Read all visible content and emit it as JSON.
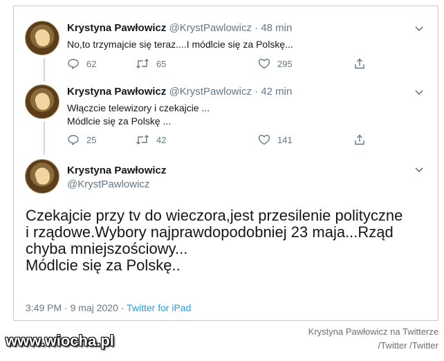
{
  "tweets": [
    {
      "name": "Krystyna Pawłowicz",
      "handle": "@KrystPawlowicz",
      "dot": "·",
      "time": "48 min",
      "lines": [
        "No,to trzymajcie się teraz....I módlcie się za Polskę..."
      ],
      "replies": "62",
      "retweets": "65",
      "likes": "295"
    },
    {
      "name": "Krystyna Pawłowicz",
      "handle": "@KrystPawlowicz",
      "dot": "·",
      "time": "42 min",
      "lines": [
        "Włączcie telewizory i czekajcie ...",
        "Módlcie się za Polskę ..."
      ],
      "replies": "25",
      "retweets": "42",
      "likes": "141"
    }
  ],
  "main_tweet": {
    "name": "Krystyna Pawłowicz",
    "handle": "@KrystPawlowicz",
    "lines": [
      "Czekajcie przy tv do wieczora,jest przesilenie polityczne",
      "i rządowe.Wybory najprawdopodobniej 23 maja...Rząd",
      "chyba mniejszościowy...",
      "Módlcie się za Polskę.."
    ],
    "time": "3:49 PM",
    "date": "9 maj 2020",
    "sep": "·",
    "source": "Twitter for iPad"
  },
  "watermark": "www.wiocha.pl",
  "credit": {
    "line1": "Krystyna Pawłowicz na Twitterze",
    "line2": "/Twitter /Twitter"
  },
  "icons": [
    "avatar",
    "chevron-down-icon",
    "reply-icon",
    "retweet-icon",
    "like-icon",
    "share-icon"
  ],
  "colors": {
    "accent": "#1da1f2",
    "muted": "#657786",
    "text": "#14171a"
  }
}
